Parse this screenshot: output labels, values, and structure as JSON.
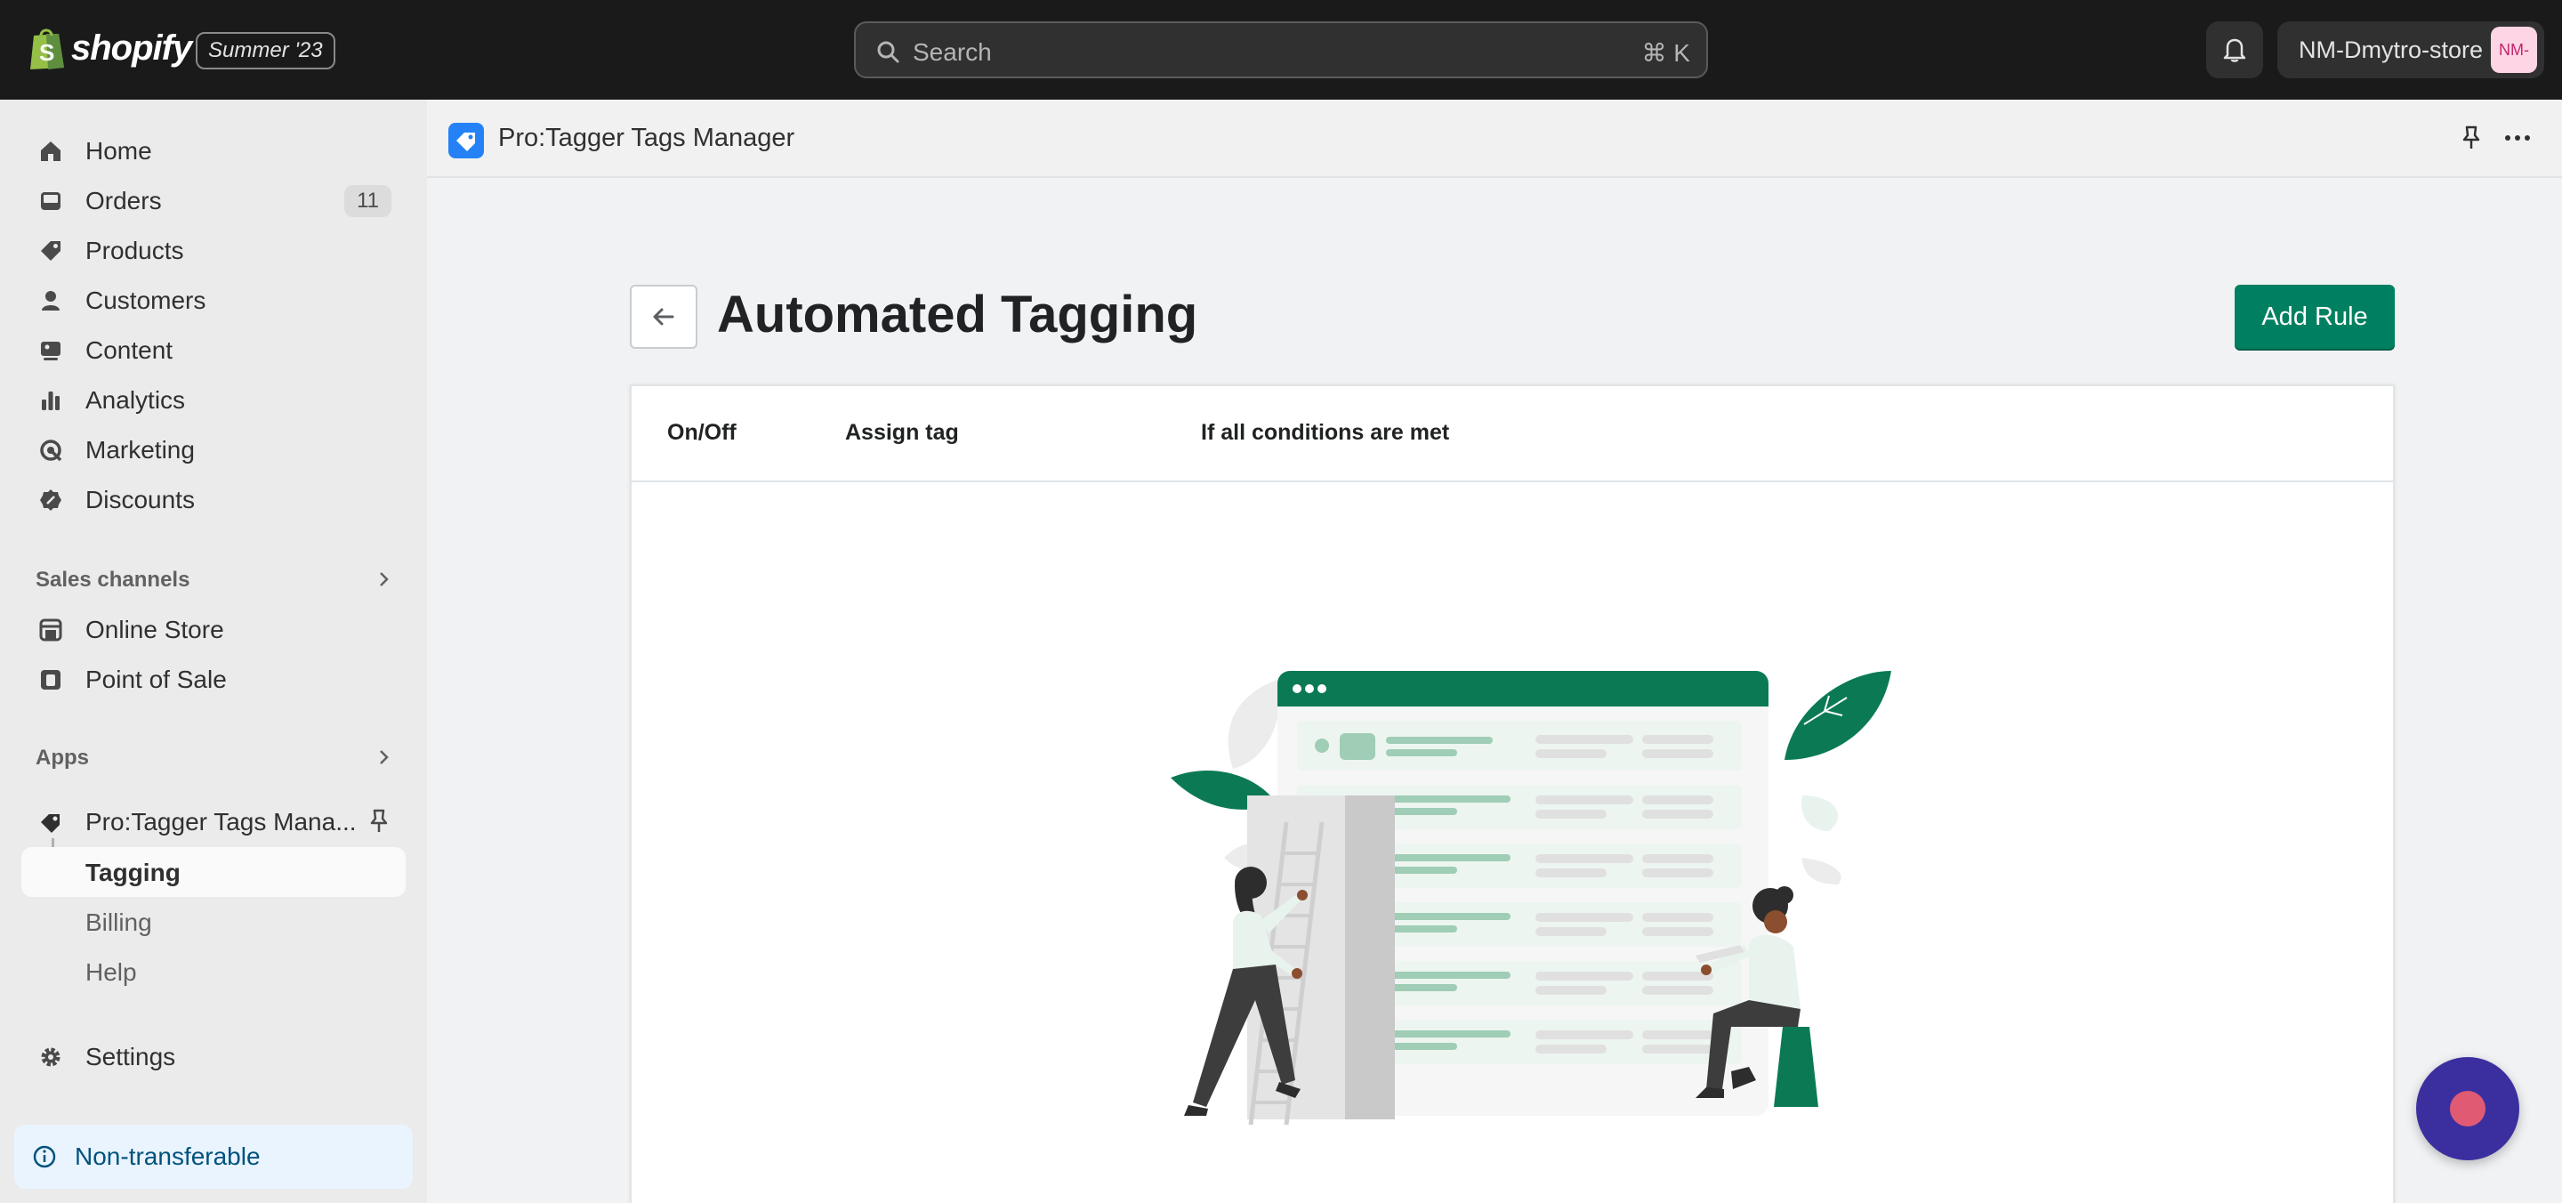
{
  "topbar": {
    "brand": "shopify",
    "edition": "Summer '23",
    "search_placeholder": "Search",
    "search_shortcut": "⌘ K",
    "store_name": "NM-Dmytro-store",
    "store_initials": "NM-"
  },
  "sidebar": {
    "main_items": [
      {
        "label": "Home",
        "icon": "home-icon"
      },
      {
        "label": "Orders",
        "icon": "inbox-icon",
        "badge": "11"
      },
      {
        "label": "Products",
        "icon": "tag-icon"
      },
      {
        "label": "Customers",
        "icon": "person-icon"
      },
      {
        "label": "Content",
        "icon": "content-icon"
      },
      {
        "label": "Analytics",
        "icon": "bar-chart-icon"
      },
      {
        "label": "Marketing",
        "icon": "target-icon"
      },
      {
        "label": "Discounts",
        "icon": "discount-icon"
      }
    ],
    "sales_channels": {
      "title": "Sales channels",
      "items": [
        {
          "label": "Online Store",
          "icon": "store-icon"
        },
        {
          "label": "Point of Sale",
          "icon": "pos-icon"
        }
      ]
    },
    "apps": {
      "title": "Apps",
      "app_name": "Pro:Tagger Tags Mana...",
      "sub_items": [
        "Tagging",
        "Billing",
        "Help"
      ]
    },
    "settings_label": "Settings",
    "notice_label": "Non-transferable"
  },
  "app_header": {
    "title": "Pro:Tagger Tags Manager"
  },
  "page": {
    "title": "Automated Tagging",
    "add_rule_label": "Add Rule",
    "table_headers": [
      "On/Off",
      "Assign tag",
      "If all conditions are met"
    ]
  },
  "colors": {
    "primary_green": "#008060",
    "topbar": "#1a1a1a",
    "chat_bubble": "#3b2fa0"
  }
}
